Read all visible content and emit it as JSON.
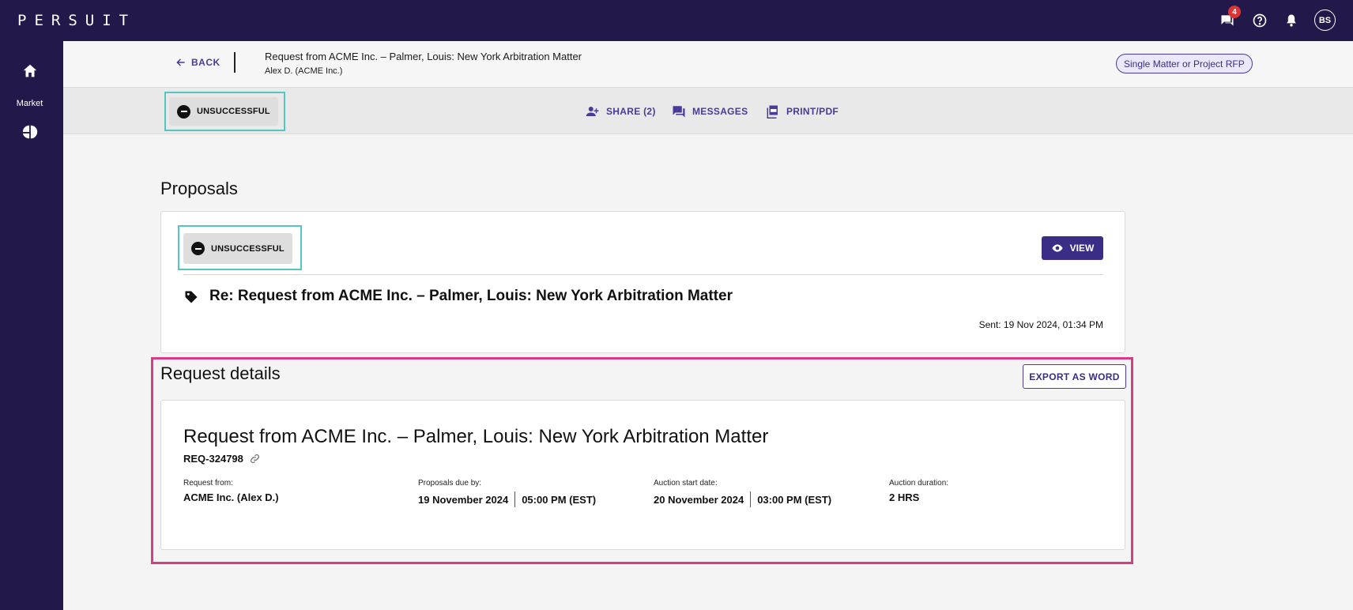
{
  "topbar": {
    "logo": "PERSUIT",
    "message_badge": "4",
    "icons": [
      "messages-icon",
      "help-icon",
      "bell-icon"
    ],
    "avatar_initials": "BS"
  },
  "sidenav": {
    "items": [
      {
        "icon": "home-icon",
        "label": ""
      },
      {
        "icon": "market-icon",
        "label": "Market"
      }
    ]
  },
  "header": {
    "back_label": "BACK",
    "title": "Request from ACME Inc. – Palmer, Louis: New York Arbitration Matter",
    "subtitle": "Alex D. (ACME Inc.)",
    "rfp_type": "Single Matter or Project RFP"
  },
  "actionbar": {
    "status": "UNSUCCESSFUL",
    "share_label": "SHARE (2)",
    "messages_label": "MESSAGES",
    "print_label": "PRINT/PDF"
  },
  "proposals": {
    "heading": "Proposals",
    "status": "UNSUCCESSFUL",
    "view_label": "VIEW",
    "title": "Re: Request from ACME Inc. – Palmer, Louis: New York Arbitration Matter",
    "sent": "Sent: 19 Nov 2024, 01:34 PM"
  },
  "request_details": {
    "heading": "Request details",
    "export_label": "EXPORT AS WORD",
    "title": "Request from ACME Inc. – Palmer, Louis: New York Arbitration Matter",
    "req_id": "REQ-324798",
    "fields": {
      "request_from_label": "Request from:",
      "request_from_value": "ACME Inc. (Alex D.)",
      "proposals_due_label": "Proposals due by:",
      "proposals_due_date": "19 November 2024",
      "proposals_due_time": "05:00 PM (EST)",
      "auction_start_label": "Auction start date:",
      "auction_start_date": "20 November 2024",
      "auction_start_time": "03:00 PM (EST)",
      "auction_duration_label": "Auction duration:",
      "auction_duration_value": "2 HRS"
    }
  },
  "colors": {
    "nav_bg": "#22194a",
    "accent": "#3a2d85",
    "highlight_teal": "#52c7c0",
    "highlight_pink": "#d83d83",
    "badge_red": "#d93535"
  }
}
